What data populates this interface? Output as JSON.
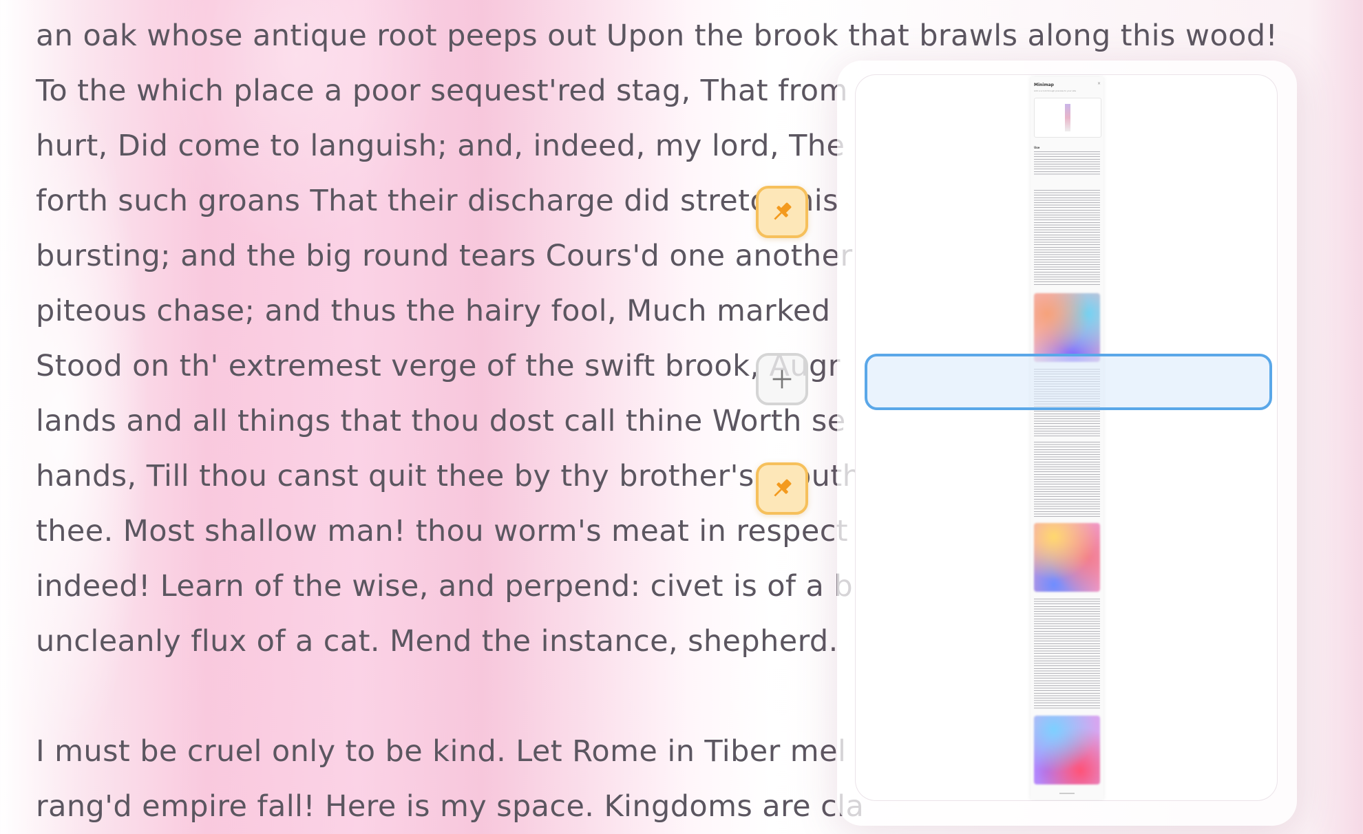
{
  "document": {
    "lines": [
      "an oak whose antique root peeps out Upon the brook that brawls along this wood!",
      "To the which place a poor sequest'red stag, That from",
      "hurt, Did come to languish; and, indeed, my lord, The",
      "forth such groans That their discharge did stretch his",
      "bursting; and the big round tears Cours'd one another",
      "piteous chase; and thus the hairy fool, Much marked",
      "Stood on th' extremest verge of the swift brook, Augr",
      "lands and all things that thou dost call thine Worth se",
      "hands, Till thou canst quit thee by thy brother's mouth",
      "thee. Most shallow man! thou worm's meat in respect",
      "indeed! Learn of the wise, and perpend: civet is of a b",
      "uncleanly flux of a cat. Mend the instance, shepherd."
    ],
    "lines2": [
      "I must be cruel only to be kind. Let Rome in Tiber mel",
      "rang'd empire fall! Here is my space. Kingdoms are cla"
    ]
  },
  "minimap": {
    "title": "Minimap",
    "subtitle": "Add a scroll-through preview to your site",
    "close": "×",
    "section": "Use"
  },
  "buttons": {
    "pin_icon": "pushpin-icon",
    "add_icon": "plus-icon",
    "pin_color": "#f6c05b",
    "viewport_color": "#5aa7e8"
  }
}
